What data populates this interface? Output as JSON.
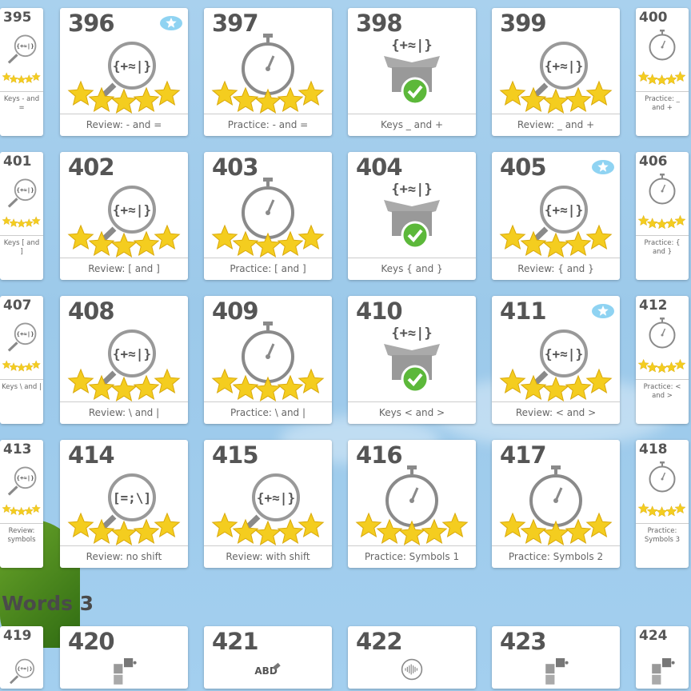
{
  "section_heading": "Words 3",
  "colors": {
    "star": "#f4cd1f",
    "check": "#5cb83a",
    "icon": "#8a8a8a",
    "badge": "#8fd3f2"
  },
  "cards": [
    {
      "number": "395",
      "label": "Keys - and =",
      "type": "review",
      "stars": 5,
      "badge": false,
      "col": 0,
      "row": 0
    },
    {
      "number": "396",
      "label": "Review: - and =",
      "type": "review",
      "stars": 5,
      "badge": true,
      "col": 1,
      "row": 0
    },
    {
      "number": "397",
      "label": "Practice: - and =",
      "type": "practice",
      "stars": 5,
      "badge": false,
      "col": 2,
      "row": 0
    },
    {
      "number": "398",
      "label": "Keys _ and +",
      "type": "keys",
      "stars": 0,
      "badge": false,
      "col": 3,
      "row": 0
    },
    {
      "number": "399",
      "label": "Review: _ and +",
      "type": "review",
      "stars": 5,
      "badge": false,
      "col": 4,
      "row": 0
    },
    {
      "number": "400",
      "label": "Practice: _ and +",
      "type": "practice",
      "stars": 5,
      "badge": false,
      "col": 5,
      "row": 0
    },
    {
      "number": "401",
      "label": "Keys [ and ]",
      "type": "review",
      "stars": 5,
      "badge": false,
      "col": 0,
      "row": 1
    },
    {
      "number": "402",
      "label": "Review: [ and ]",
      "type": "review",
      "stars": 5,
      "badge": false,
      "col": 1,
      "row": 1
    },
    {
      "number": "403",
      "label": "Practice: [ and ]",
      "type": "practice",
      "stars": 5,
      "badge": false,
      "col": 2,
      "row": 1
    },
    {
      "number": "404",
      "label": "Keys { and }",
      "type": "keys",
      "stars": 0,
      "badge": false,
      "col": 3,
      "row": 1
    },
    {
      "number": "405",
      "label": "Review: { and }",
      "type": "review",
      "stars": 5,
      "badge": true,
      "col": 4,
      "row": 1
    },
    {
      "number": "406",
      "label": "Practice: { and }",
      "type": "practice",
      "stars": 5,
      "badge": false,
      "col": 5,
      "row": 1
    },
    {
      "number": "407",
      "label": "Keys \\ and |",
      "type": "review",
      "stars": 5,
      "badge": false,
      "col": 0,
      "row": 2
    },
    {
      "number": "408",
      "label": "Review: \\ and |",
      "type": "review",
      "stars": 5,
      "badge": false,
      "col": 1,
      "row": 2
    },
    {
      "number": "409",
      "label": "Practice: \\ and |",
      "type": "practice",
      "stars": 5,
      "badge": false,
      "col": 2,
      "row": 2
    },
    {
      "number": "410",
      "label": "Keys < and >",
      "type": "keys",
      "stars": 0,
      "badge": false,
      "col": 3,
      "row": 2
    },
    {
      "number": "411",
      "label": "Review: < and >",
      "type": "review",
      "stars": 5,
      "badge": true,
      "col": 4,
      "row": 2
    },
    {
      "number": "412",
      "label": "Practice: < and >",
      "type": "practice",
      "stars": 5,
      "badge": false,
      "col": 5,
      "row": 2
    },
    {
      "number": "413",
      "label": "Review: symbols",
      "type": "review",
      "stars": 5,
      "badge": false,
      "col": 0,
      "row": 3
    },
    {
      "number": "414",
      "label": "Review: no shift",
      "type": "review2",
      "stars": 5,
      "badge": false,
      "col": 1,
      "row": 3
    },
    {
      "number": "415",
      "label": "Review: with shift",
      "type": "review",
      "stars": 5,
      "badge": false,
      "col": 2,
      "row": 3
    },
    {
      "number": "416",
      "label": "Practice: Symbols 1",
      "type": "practice",
      "stars": 5,
      "badge": false,
      "col": 3,
      "row": 3
    },
    {
      "number": "417",
      "label": "Practice: Symbols 2",
      "type": "practice",
      "stars": 5,
      "badge": false,
      "col": 4,
      "row": 3
    },
    {
      "number": "418",
      "label": "Practice: Symbols 3",
      "type": "practice",
      "stars": 5,
      "badge": false,
      "col": 5,
      "row": 3
    },
    {
      "number": "419",
      "label": "",
      "type": "review",
      "stars": 0,
      "badge": false,
      "col": 0,
      "row": 4
    },
    {
      "number": "420",
      "label": "",
      "type": "puzzle",
      "stars": 0,
      "badge": false,
      "col": 1,
      "row": 4
    },
    {
      "number": "421",
      "label": "",
      "type": "abc",
      "stars": 0,
      "badge": false,
      "col": 2,
      "row": 4
    },
    {
      "number": "422",
      "label": "",
      "type": "audio",
      "stars": 0,
      "badge": false,
      "col": 3,
      "row": 4
    },
    {
      "number": "423",
      "label": "",
      "type": "puzzle",
      "stars": 0,
      "badge": false,
      "col": 4,
      "row": 4
    },
    {
      "number": "424",
      "label": "",
      "type": "puzzle",
      "stars": 0,
      "badge": false,
      "col": 5,
      "row": 4
    }
  ]
}
